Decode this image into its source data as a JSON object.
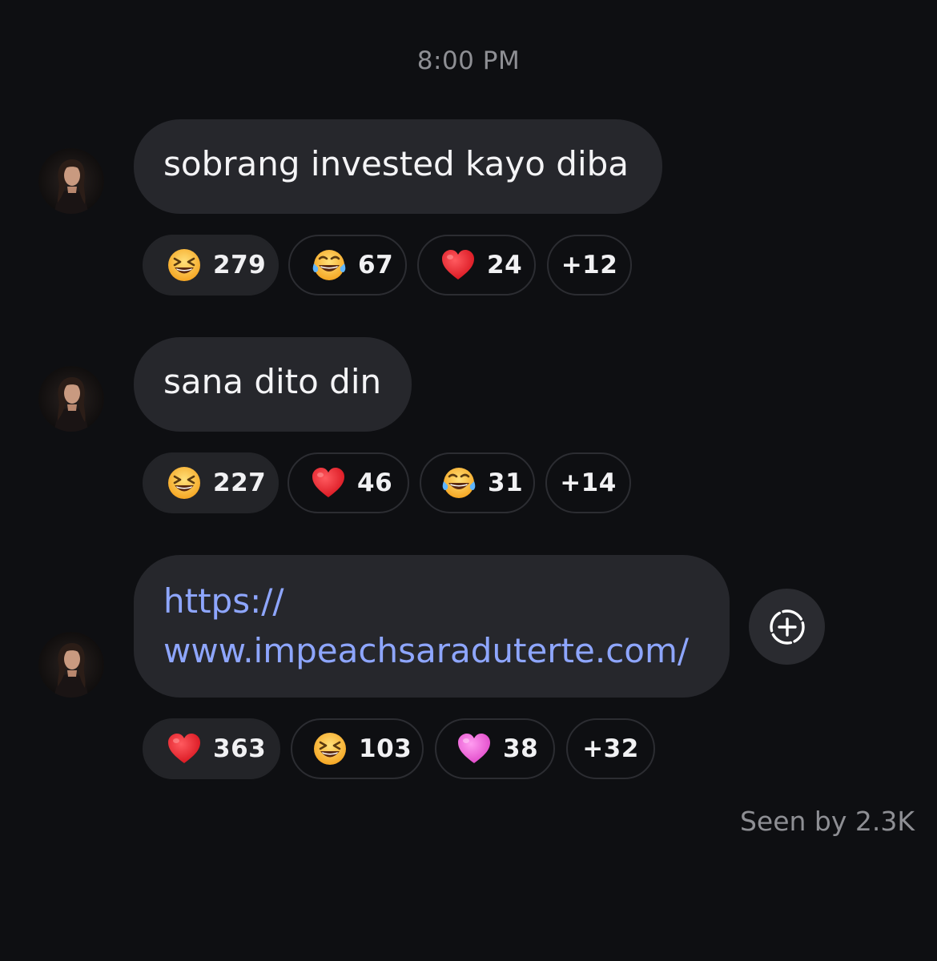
{
  "timestamp": "8:00 PM",
  "messages": [
    {
      "text": "sobrang invested kayo diba",
      "reactions": [
        {
          "icon": "grinning-squint-emoji",
          "count": "279"
        },
        {
          "icon": "tears-of-joy-emoji",
          "count": "67"
        },
        {
          "icon": "red-heart-emoji",
          "count": "24"
        },
        {
          "icon": "",
          "count": "+12"
        }
      ]
    },
    {
      "text": "sana dito din",
      "reactions": [
        {
          "icon": "grinning-squint-emoji",
          "count": "227"
        },
        {
          "icon": "red-heart-emoji",
          "count": "46"
        },
        {
          "icon": "tears-of-joy-emoji",
          "count": "31"
        },
        {
          "icon": "",
          "count": "+14"
        }
      ]
    },
    {
      "text_line1": "https://",
      "text_line2": "www.impeachsaraduterte.com/",
      "reactions": [
        {
          "icon": "red-heart-emoji",
          "count": "363"
        },
        {
          "icon": "grinning-squint-emoji",
          "count": "103"
        },
        {
          "icon": "pink-heart-emoji",
          "count": "38"
        },
        {
          "icon": "",
          "count": "+32"
        }
      ]
    }
  ],
  "add_reaction_icon": "add-reaction-icon",
  "seen_by": "Seen by 2.3K",
  "colors": {
    "background": "#0e0f12",
    "bubble": "#26272c",
    "link": "#8ea6ff",
    "muted_text": "#8e8f94"
  }
}
